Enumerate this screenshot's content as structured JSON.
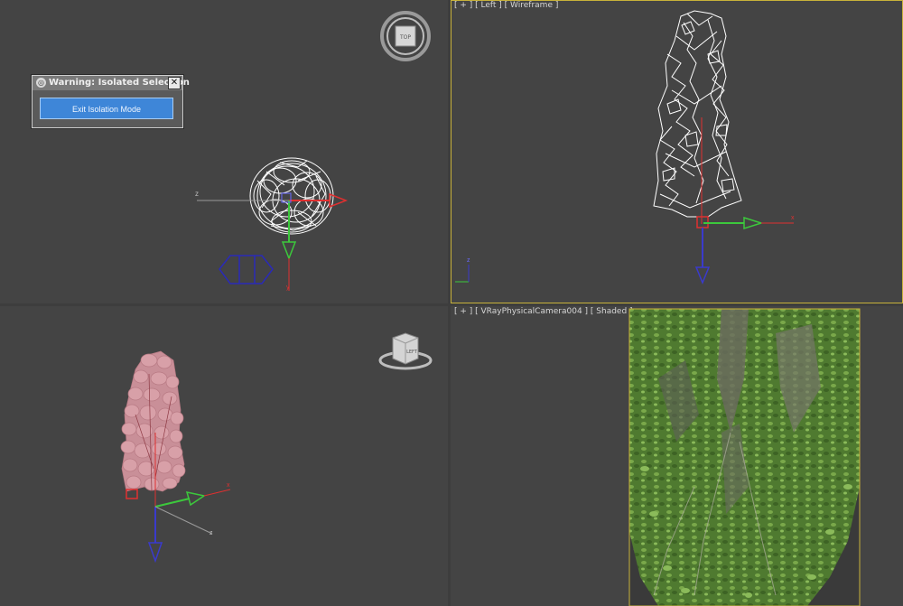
{
  "viewports": {
    "top": {
      "cube_label": "TOP"
    },
    "left": {
      "label": "[ + ] [ Left ] [ Wireframe ]"
    },
    "persp": {
      "cube_label": "LEFT"
    },
    "camera": {
      "label": "[ + ] [ VRayPhysicalCamera004 ] [ Shaded ]"
    }
  },
  "axes": {
    "x": "x",
    "y": "y",
    "z": "z"
  },
  "warning": {
    "title": "Warning: Isolated Selection",
    "close": "✕",
    "button": "Exit Isolation Mode"
  },
  "colors": {
    "viewport_bg": "#444444",
    "wire": "#ffffff",
    "foliage_pink": "#d8a0a8",
    "foliage_green": "#5d8a3c",
    "gizmo_red": "#e03030",
    "gizmo_green": "#3cc83c",
    "gizmo_blue": "#3a3acc",
    "active_border": "#c8b23a",
    "dialog_button": "#3e86d8"
  }
}
